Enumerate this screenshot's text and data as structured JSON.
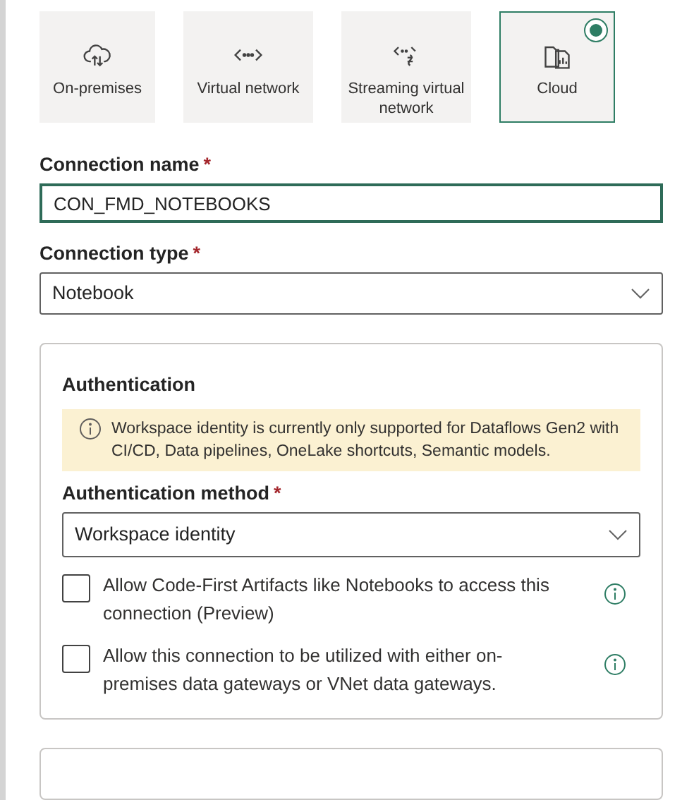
{
  "connection_types": [
    {
      "kind": "gateway",
      "label": "On-premises",
      "selected": false
    },
    {
      "kind": "vnet",
      "label": "Virtual network",
      "selected": false
    },
    {
      "kind": "streaming",
      "label": "Streaming virtual network",
      "selected": false
    },
    {
      "kind": "cloud",
      "label": "Cloud",
      "selected": true
    }
  ],
  "connection_name": {
    "label": "Connection name",
    "required": "*",
    "value": "CON_FMD_NOTEBOOKS"
  },
  "connection_type": {
    "label": "Connection type",
    "required": "*",
    "value": "Notebook"
  },
  "authentication": {
    "title": "Authentication",
    "notice": "Workspace identity is currently only supported for Dataflows Gen2 with CI/CD, Data pipelines, OneLake shortcuts, Semantic models.",
    "method": {
      "label": "Authentication method",
      "required": "*",
      "value": "Workspace identity"
    },
    "options": [
      {
        "label": "Allow Code-First Artifacts like Notebooks to access this connection (Preview)",
        "checked": false
      },
      {
        "label": "Allow this connection to be utilized with either on-premises data gateways or VNet data gateways.",
        "checked": false
      }
    ]
  }
}
